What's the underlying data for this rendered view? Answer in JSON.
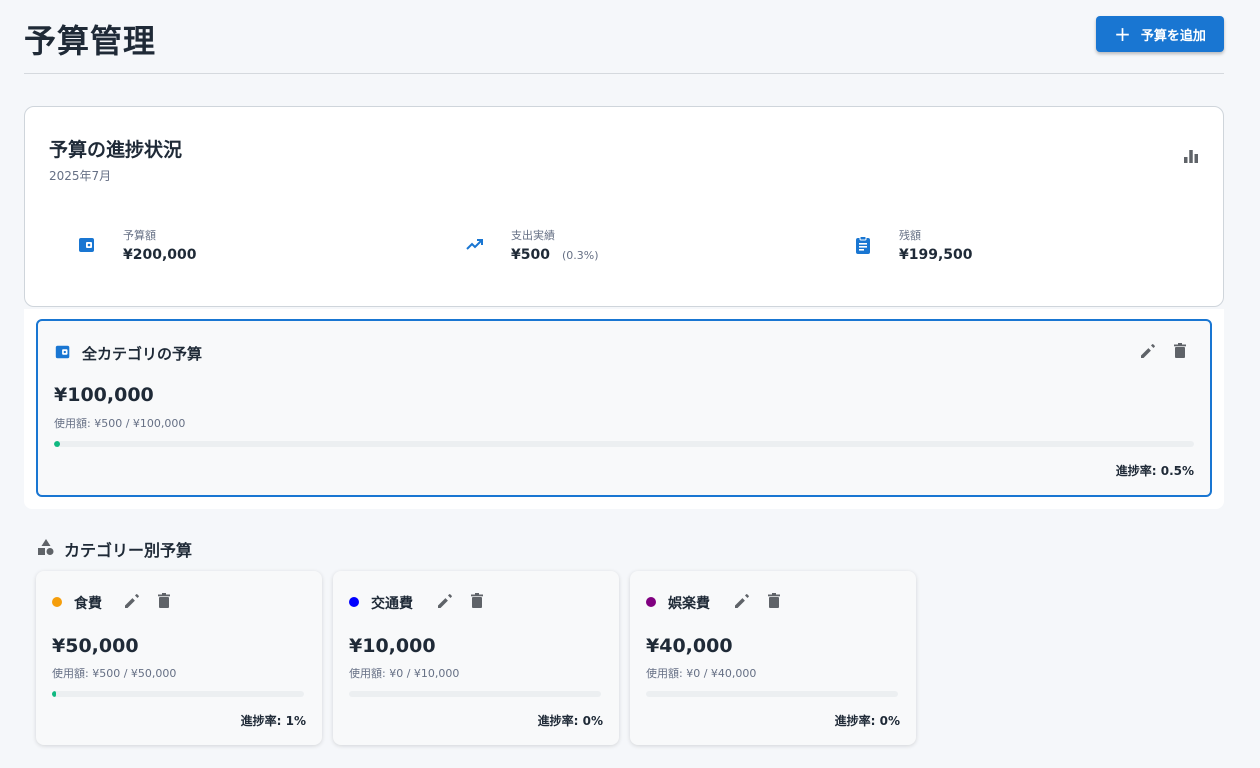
{
  "header": {
    "title": "予算管理",
    "add_button_label": "予算を追加",
    "add_icon": "plus-icon"
  },
  "summary": {
    "title": "予算の進捗状況",
    "period": "2025年7月",
    "chart_icon": "bar-chart-icon",
    "stats": {
      "budget": {
        "icon": "wallet-icon",
        "label": "予算額",
        "value": "¥200,000"
      },
      "spent": {
        "icon": "trending-up-icon",
        "label": "支出実績",
        "value": "¥500",
        "pct": "(0.3%)"
      },
      "remaining": {
        "icon": "clipboard-icon",
        "label": "残額",
        "value": "¥199,500"
      }
    }
  },
  "overall_budget": {
    "icon": "wallet-icon",
    "title": "全カテゴリの予算",
    "amount": "¥100,000",
    "used": "使用額: ¥500 / ¥100,000",
    "progress_percent": 0.5,
    "rate_label": "進捗率:",
    "rate_value": "0.5%",
    "edit_icon": "pencil-icon",
    "delete_icon": "trash-icon"
  },
  "category_section": {
    "icon": "category-shapes-icon",
    "title": "カテゴリー別予算"
  },
  "categories": [
    {
      "name": "食費",
      "dot_color": "#f59e0b",
      "amount": "¥50,000",
      "used": "使用額: ¥500 / ¥50,000",
      "progress_percent": 1,
      "rate_label": "進捗率:",
      "rate_value": "1%"
    },
    {
      "name": "交通費",
      "dot_color": "#0000ff",
      "amount": "¥10,000",
      "used": "使用額: ¥0 / ¥10,000",
      "progress_percent": 0,
      "rate_label": "進捗率:",
      "rate_value": "0%"
    },
    {
      "name": "娯楽費",
      "dot_color": "#800080",
      "amount": "¥40,000",
      "used": "使用額: ¥0 / ¥40,000",
      "progress_percent": 0,
      "rate_label": "進捗率:",
      "rate_value": "0%"
    }
  ],
  "colors": {
    "accent": "#1976d2",
    "progress": "#10b981",
    "icon_gray": "#5f6368"
  }
}
